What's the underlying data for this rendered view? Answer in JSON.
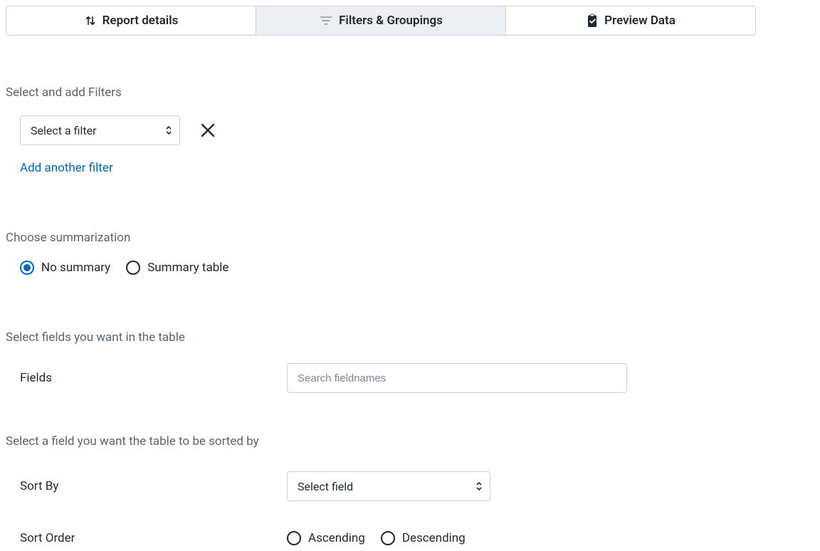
{
  "tabs": {
    "report_details": "Report details",
    "filters_groupings": "Filters & Groupings",
    "preview_data": "Preview Data"
  },
  "filters": {
    "heading": "Select and add Filters",
    "select_placeholder": "Select a filter",
    "add_link": "Add another filter"
  },
  "summarization": {
    "heading": "Choose summarization",
    "no_summary": "No summary",
    "summary_table": "Summary table"
  },
  "fields": {
    "heading": "Select fields you want in the table",
    "label": "Fields",
    "search_placeholder": "Search fieldnames"
  },
  "sort": {
    "heading": "Select a field you want the table to be sorted by",
    "sort_by_label": "Sort By",
    "select_field": "Select field",
    "sort_order_label": "Sort Order",
    "ascending": "Ascending",
    "descending": "Descending"
  }
}
